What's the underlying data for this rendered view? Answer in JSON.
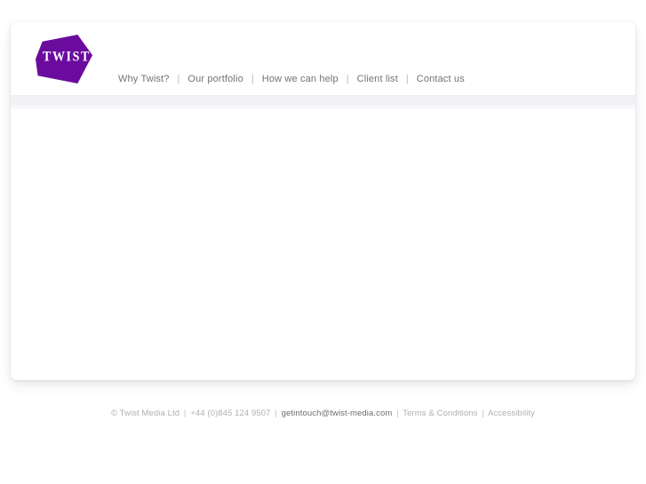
{
  "brand": {
    "logo_text": "TWIST",
    "logo_icon": "twist-pennant-logo",
    "purple": "#6b0b9e"
  },
  "nav": {
    "separator": "|",
    "items": [
      {
        "label": "Why Twist?"
      },
      {
        "label": "Our portfolio"
      },
      {
        "label": "How we can help"
      },
      {
        "label": "Client list"
      },
      {
        "label": "Contact us"
      }
    ]
  },
  "content": {
    "body_text": ""
  },
  "footer": {
    "copyright": "© Twist Media Ltd",
    "sep1": "|",
    "phone": "+44 (0)845 124 9507",
    "sep2": "|",
    "email": "getintouch@twist-media.com",
    "sep3": "|",
    "terms": "Terms & Conditions",
    "sep4": "|",
    "accessibility": "Accessibility"
  }
}
